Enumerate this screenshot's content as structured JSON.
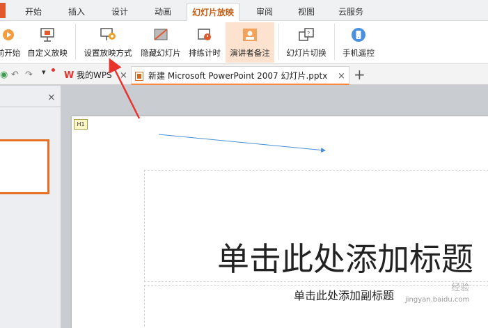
{
  "menu": {
    "tabs": [
      "开始",
      "插入",
      "设计",
      "动画",
      "幻灯片放映",
      "审阅",
      "视图",
      "云服务"
    ],
    "active_tab": "幻灯片放映"
  },
  "ribbon": {
    "buttons": [
      {
        "label": "前开始",
        "icon": "play-from-current-icon"
      },
      {
        "label": "自定义放映",
        "icon": "custom-show-icon"
      },
      {
        "label": "设置放映方式",
        "icon": "setup-show-icon"
      },
      {
        "label": "隐藏幻灯片",
        "icon": "hide-slide-icon"
      },
      {
        "label": "排练计时",
        "icon": "rehearse-timing-icon"
      },
      {
        "label": "演讲者备注",
        "icon": "speaker-notes-icon"
      },
      {
        "label": "幻灯片切换",
        "icon": "slide-transition-icon"
      },
      {
        "label": "手机遥控",
        "icon": "phone-remote-icon"
      }
    ],
    "highlighted": "演讲者备注"
  },
  "tabbar": {
    "tabs": [
      {
        "label": "我的WPS",
        "icon": "wps-logo-icon"
      },
      {
        "label": "新建 Microsoft PowerPoint 2007 幻灯片.pptx",
        "icon": "pptx-file-icon"
      }
    ],
    "new_tab_label": "+",
    "close_glyph": "×"
  },
  "thumbnail_pane": {
    "close_glyph": "×"
  },
  "slide": {
    "badge": "H1",
    "title_placeholder": "单击此处添加标题",
    "subtitle_placeholder": "单击此处添加副标题"
  },
  "watermark": {
    "text": "经验",
    "url": "jingyan.baidu.com"
  },
  "colors": {
    "accent": "#c55a11",
    "highlight": "#fde3cf",
    "annotation_red": "#e8322b",
    "annotation_blue": "#4a8fd6"
  }
}
